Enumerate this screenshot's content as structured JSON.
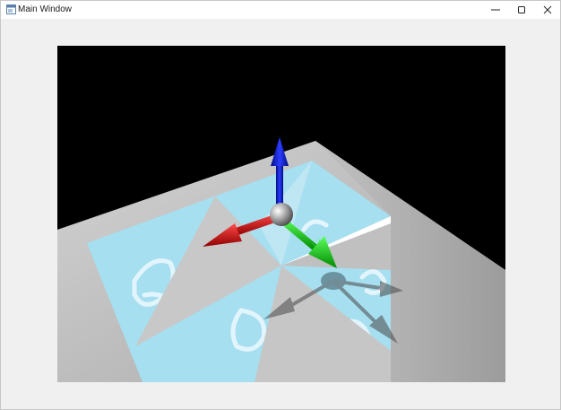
{
  "window": {
    "title": "Main Window",
    "icon": "app-window-icon",
    "controls": [
      {
        "name": "minimize",
        "icon": "minimize-icon"
      },
      {
        "name": "maximize",
        "icon": "maximize-icon"
      },
      {
        "name": "close",
        "icon": "close-icon"
      }
    ]
  },
  "scene": {
    "background_color": "#000000",
    "floor_color": "#c4c4c4",
    "water_color": "#a6dff0",
    "gizmo_axes": [
      {
        "axis": "x",
        "color": "#d40000"
      },
      {
        "axis": "y",
        "color": "#00c400"
      },
      {
        "axis": "z",
        "color": "#0010b0"
      }
    ],
    "gizmo_center_color": "#9a9a9a",
    "shadow_color": "#5e7680"
  }
}
